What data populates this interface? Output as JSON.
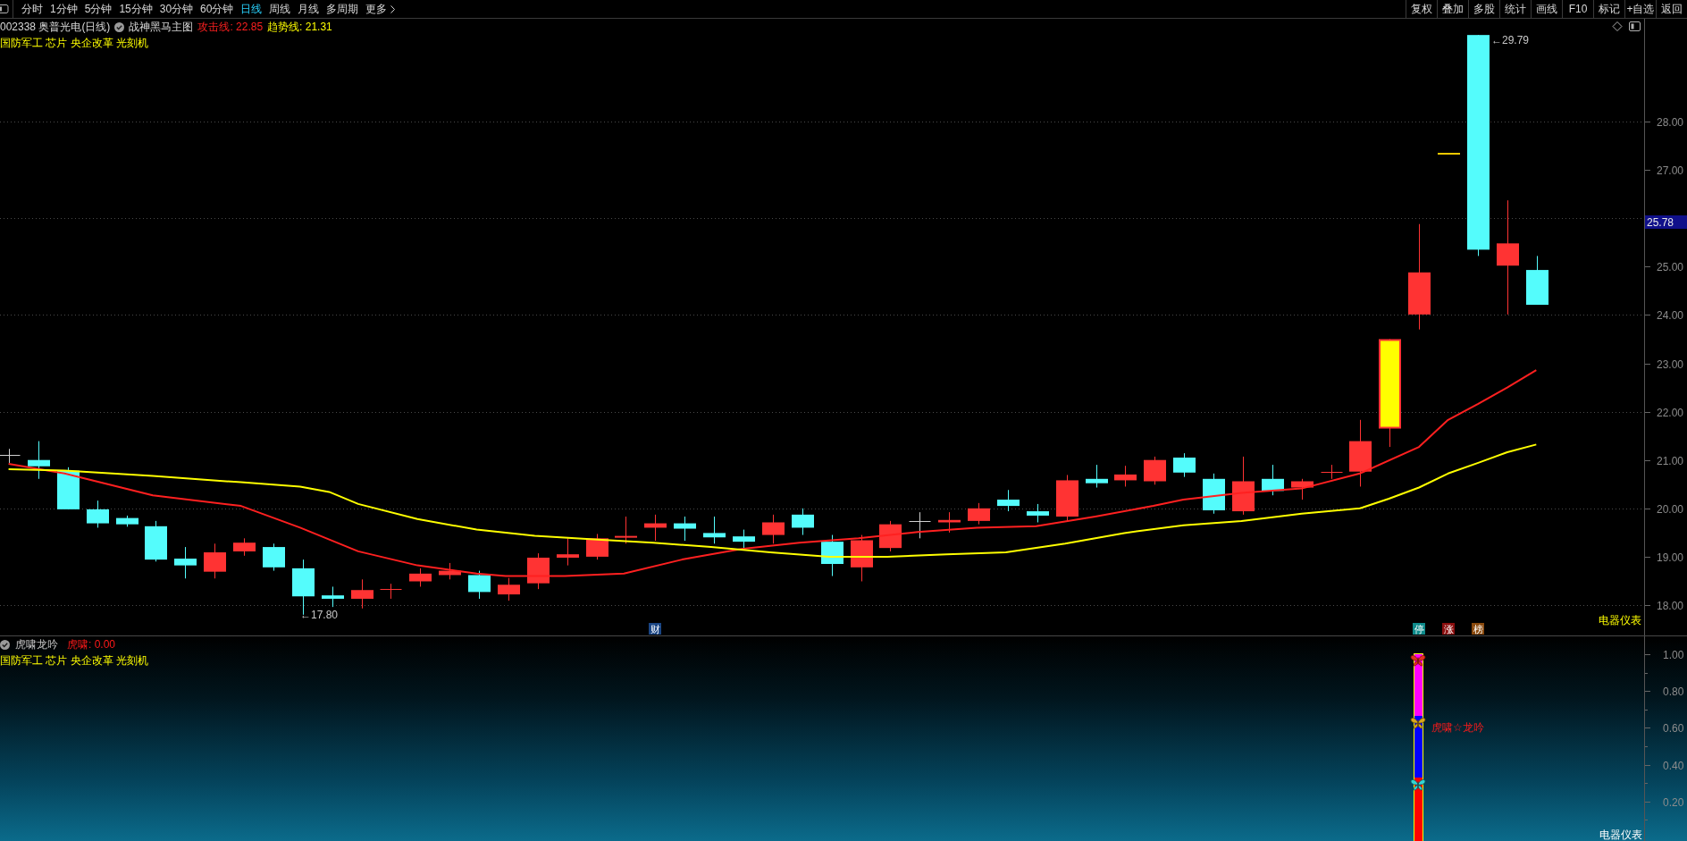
{
  "toolbar": {
    "periods": [
      {
        "label": "分时",
        "selected": false
      },
      {
        "label": "1分钟",
        "selected": false
      },
      {
        "label": "5分钟",
        "selected": false
      },
      {
        "label": "15分钟",
        "selected": false
      },
      {
        "label": "30分钟",
        "selected": false
      },
      {
        "label": "60分钟",
        "selected": false
      },
      {
        "label": "日线",
        "selected": true
      },
      {
        "label": "周线",
        "selected": false
      },
      {
        "label": "月线",
        "selected": false
      },
      {
        "label": "多周期",
        "selected": false
      }
    ],
    "more": "更多",
    "actions": [
      "复权",
      "叠加",
      "多股",
      "统计",
      "画线",
      "F10",
      "标记",
      "+自选",
      "返回"
    ]
  },
  "main_panel": {
    "security": "002338 奥普光电(日线)",
    "indicator": "战神黑马主图",
    "indicator_values": [
      {
        "label": "攻击线: 22.85",
        "color": "#ff2020"
      },
      {
        "label": "趋势线: 21.31",
        "color": "#ffff00"
      }
    ],
    "concepts": "国防军工 芯片 央企改革 光刻机",
    "price_axis": [
      "28.00",
      "27.00",
      "25.00",
      "24.00",
      "23.00",
      "22.00",
      "21.00",
      "20.00",
      "19.00",
      "18.00"
    ],
    "current_price": "25.78",
    "high_label": "←29.79",
    "low_label": "←17.80",
    "markers": [
      {
        "text": "财",
        "color": "#1a4584"
      },
      {
        "text": "停",
        "color": "#0e8a8a"
      },
      {
        "text": "涨",
        "color": "#8a0e0e"
      },
      {
        "text": "榜",
        "color": "#8a4a0e"
      }
    ],
    "sector": "电器仪表"
  },
  "sub_panel": {
    "indicator": "虎啸龙吟",
    "value": "虎啸: 0.00",
    "concepts": "国防军工 芯片 央企改革 光刻机",
    "signal_label": "虎啸☆龙吟",
    "axis": [
      "1.00",
      "0.80",
      "0.60",
      "0.40",
      "0.20"
    ],
    "sector": "电器仪表"
  }
}
